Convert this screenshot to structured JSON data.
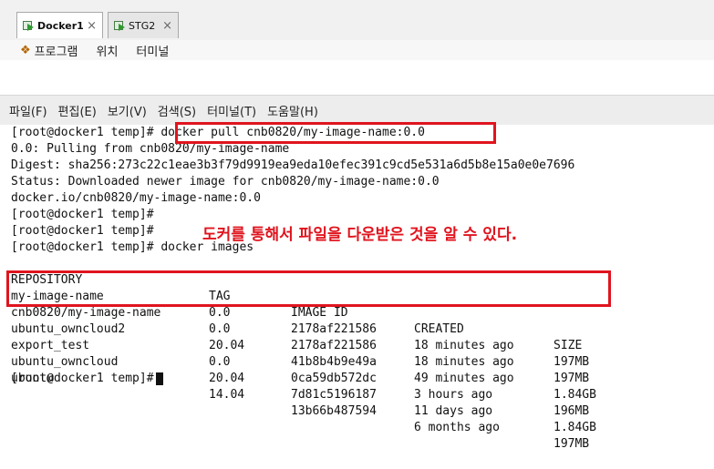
{
  "vm_tabs": [
    {
      "label": "Docker1",
      "active": true
    },
    {
      "label": "STG2",
      "active": false
    }
  ],
  "gnome_menu": [
    "프로그램",
    "위치",
    "터미널"
  ],
  "terminal_menu": [
    "파일(F)",
    "편집(E)",
    "보기(V)",
    "검색(S)",
    "터미널(T)",
    "도움말(H)"
  ],
  "terminal_lines": [
    "[root@docker1 temp]# docker pull cnb0820/my-image-name:0.0",
    "0.0: Pulling from cnb0820/my-image-name",
    "Digest: sha256:273c22c1eae3b3f79d9919ea9eda10efec391c9cd5e531a6d5b8e15a0e0e7696",
    "Status: Downloaded newer image for cnb0820/my-image-name:0.0",
    "docker.io/cnb0820/my-image-name:0.0",
    "[root@docker1 temp]#",
    "[root@docker1 temp]#",
    "[root@docker1 temp]# docker images"
  ],
  "images_table": {
    "headers": [
      "REPOSITORY",
      "TAG",
      "IMAGE ID",
      "CREATED",
      "SIZE"
    ],
    "rows": [
      [
        "my-image-name",
        "0.0",
        "2178af221586",
        "18 minutes ago",
        "197MB"
      ],
      [
        "cnb0820/my-image-name",
        "0.0",
        "2178af221586",
        "18 minutes ago",
        "197MB"
      ],
      [
        "ubuntu_owncloud2",
        "20.04",
        "41b8b4b9e49a",
        "49 minutes ago",
        "1.84GB"
      ],
      [
        "export_test",
        "0.0",
        "0ca59db572dc",
        "3 hours ago",
        "196MB"
      ],
      [
        "ubuntu_owncloud",
        "20.04",
        "7d81c5196187",
        "11 days ago",
        "1.84GB"
      ],
      [
        "ubuntu",
        "14.04",
        "13b66b487594",
        "6 months ago",
        "197MB"
      ]
    ]
  },
  "final_prompt": "[root@docker1 temp]#",
  "annotation": "도커를 통해서 파일을 다운받은 것을 알 수 있다.",
  "colors": {
    "highlight": "#e0141e"
  }
}
